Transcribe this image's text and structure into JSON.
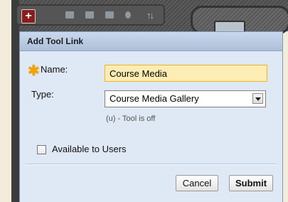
{
  "toolbar": {
    "add_symbol": "+",
    "icons": [
      "menu-grid-icon",
      "folder-icon",
      "stack-icon",
      "refresh-icon",
      "sort-icon"
    ]
  },
  "dialog": {
    "title": "Add Tool Link",
    "name_label": "Name:",
    "name_value": "Course Media",
    "required_marker": "✱",
    "type_label": "Type:",
    "type_value": "Course Media Gallery",
    "tool_status": "(u) - Tool is off",
    "available_label": "Available to Users",
    "available_checked": false,
    "cancel_label": "Cancel",
    "submit_label": "Submit"
  },
  "colors": {
    "header_bg": "#b8c9e3",
    "dialog_bg": "#dfe8f5",
    "required_star": "#f0a30a",
    "name_input_bg": "#fdedb3",
    "name_input_border": "#f0b429",
    "add_button": "#8b1c1c"
  }
}
